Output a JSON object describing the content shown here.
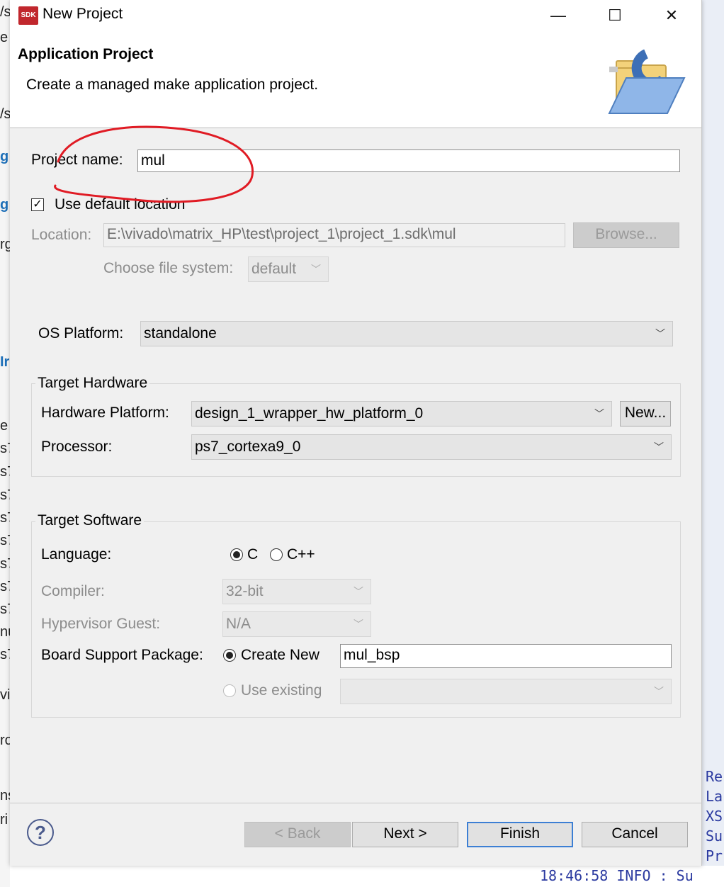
{
  "background": {
    "left_fragments": [
      "/s",
      "e",
      "/s",
      "g",
      "g",
      "rg",
      "Ir",
      "e",
      "s7",
      "s7",
      "s7",
      "s7",
      "s7",
      "s7",
      "s7",
      "s7",
      "nu",
      "s7",
      "vi",
      "ro",
      "ns",
      "ri"
    ],
    "right_fragments": [
      "Re",
      "La",
      "XS",
      "Su",
      "Pr",
      "Su"
    ],
    "log_line": "18:46:58 INFO    : Su"
  },
  "window": {
    "title": "New Project",
    "app_icon_text": "SDK",
    "minimize_symbol": "—",
    "maximize_symbol": "☐",
    "close_symbol": "✕"
  },
  "header": {
    "title": "Application Project",
    "description": "Create a managed make application project."
  },
  "project": {
    "name_label": "Project name:",
    "name_value": "mul",
    "use_default_location_label": "Use default location",
    "use_default_location_checked": true,
    "location_label": "Location:",
    "location_value": "E:\\vivado\\matrix_HP\\test\\project_1\\project_1.sdk\\mul",
    "browse_label": "Browse...",
    "file_system_label": "Choose file system:",
    "file_system_value": "default"
  },
  "os_platform": {
    "label": "OS Platform:",
    "value": "standalone"
  },
  "target_hardware": {
    "group_title": "Target Hardware",
    "hardware_platform_label": "Hardware Platform:",
    "hardware_platform_value": "design_1_wrapper_hw_platform_0",
    "new_button_label": "New...",
    "processor_label": "Processor:",
    "processor_value": "ps7_cortexa9_0"
  },
  "target_software": {
    "group_title": "Target Software",
    "language_label": "Language:",
    "language_options": [
      "C",
      "C++"
    ],
    "language_selected": "C",
    "compiler_label": "Compiler:",
    "compiler_value": "32-bit",
    "hypervisor_label": "Hypervisor Guest:",
    "hypervisor_value": "N/A",
    "bsp_label": "Board Support Package:",
    "bsp_create_new_label": "Create New",
    "bsp_name_value": "mul_bsp",
    "bsp_use_existing_label": "Use existing"
  },
  "footer": {
    "help_symbol": "?",
    "back_label": "< Back",
    "next_label": "Next >",
    "finish_label": "Finish",
    "cancel_label": "Cancel"
  },
  "colors": {
    "dialog_bg": "#f0f0f0",
    "annotation_red": "#e01b24",
    "default_button_border": "#3c7fd4"
  }
}
